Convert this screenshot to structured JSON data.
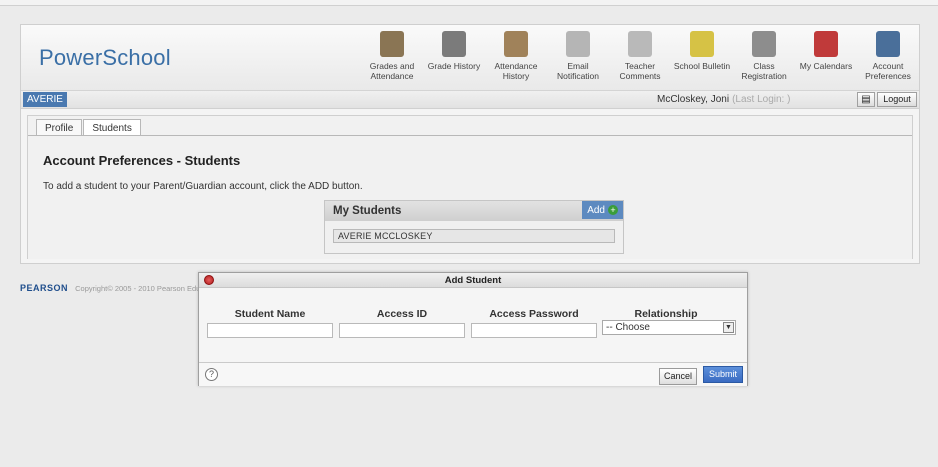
{
  "app": {
    "logo": "PowerSchool"
  },
  "nav": [
    {
      "name": "nav-grades-attendance",
      "icon": "grades-icon",
      "label": "Grades and Attendance",
      "color": "#8a7554"
    },
    {
      "name": "nav-grade-history",
      "icon": "grade-history-icon",
      "label": "Grade History",
      "color": "#7b7b7b"
    },
    {
      "name": "nav-attendance-history",
      "icon": "attendance-history-icon",
      "label": "Attendance History",
      "color": "#a0825a"
    },
    {
      "name": "nav-email-notification",
      "icon": "email-icon",
      "label": "Email Notification",
      "color": "#b5b5b5"
    },
    {
      "name": "nav-teacher-comments",
      "icon": "comments-icon",
      "label": "Teacher Comments",
      "color": "#b9b9b9"
    },
    {
      "name": "nav-school-bulletin",
      "icon": "bulletin-icon",
      "label": "School Bulletin",
      "color": "#d6c245"
    },
    {
      "name": "nav-class-registration",
      "icon": "registration-icon",
      "label": "Class Registration",
      "color": "#8d8d8d"
    },
    {
      "name": "nav-my-calendars",
      "icon": "calendar-icon",
      "label": "My Calendars",
      "color": "#c03a3a"
    },
    {
      "name": "nav-account-preferences",
      "icon": "gear-icon",
      "label": "Account Preferences",
      "color": "#4a6f9a"
    }
  ],
  "userbar": {
    "student": "AVERIE",
    "user": "McCloskey, Joni",
    "last_login": "(Last Login: )",
    "logout": "Logout",
    "help": "?"
  },
  "tabs": [
    "Profile",
    "Students"
  ],
  "page": {
    "title": "Account Preferences - Students",
    "description": "To add a student to your Parent/Guardian account, click the ADD button."
  },
  "my_students": {
    "header": "My Students",
    "add_label": "Add",
    "rows": [
      "AVERIE MCCLOSKEY"
    ]
  },
  "footer": {
    "brand": "PEARSON",
    "copyright": "Copyright© 2005 - 2010 Pearson Educ"
  },
  "modal": {
    "title": "Add Student",
    "columns": [
      "Student Name",
      "Access ID",
      "Access Password",
      "Relationship"
    ],
    "relationship_value": "-- Choose",
    "cancel": "Cancel",
    "submit": "Submit",
    "help": "?"
  }
}
